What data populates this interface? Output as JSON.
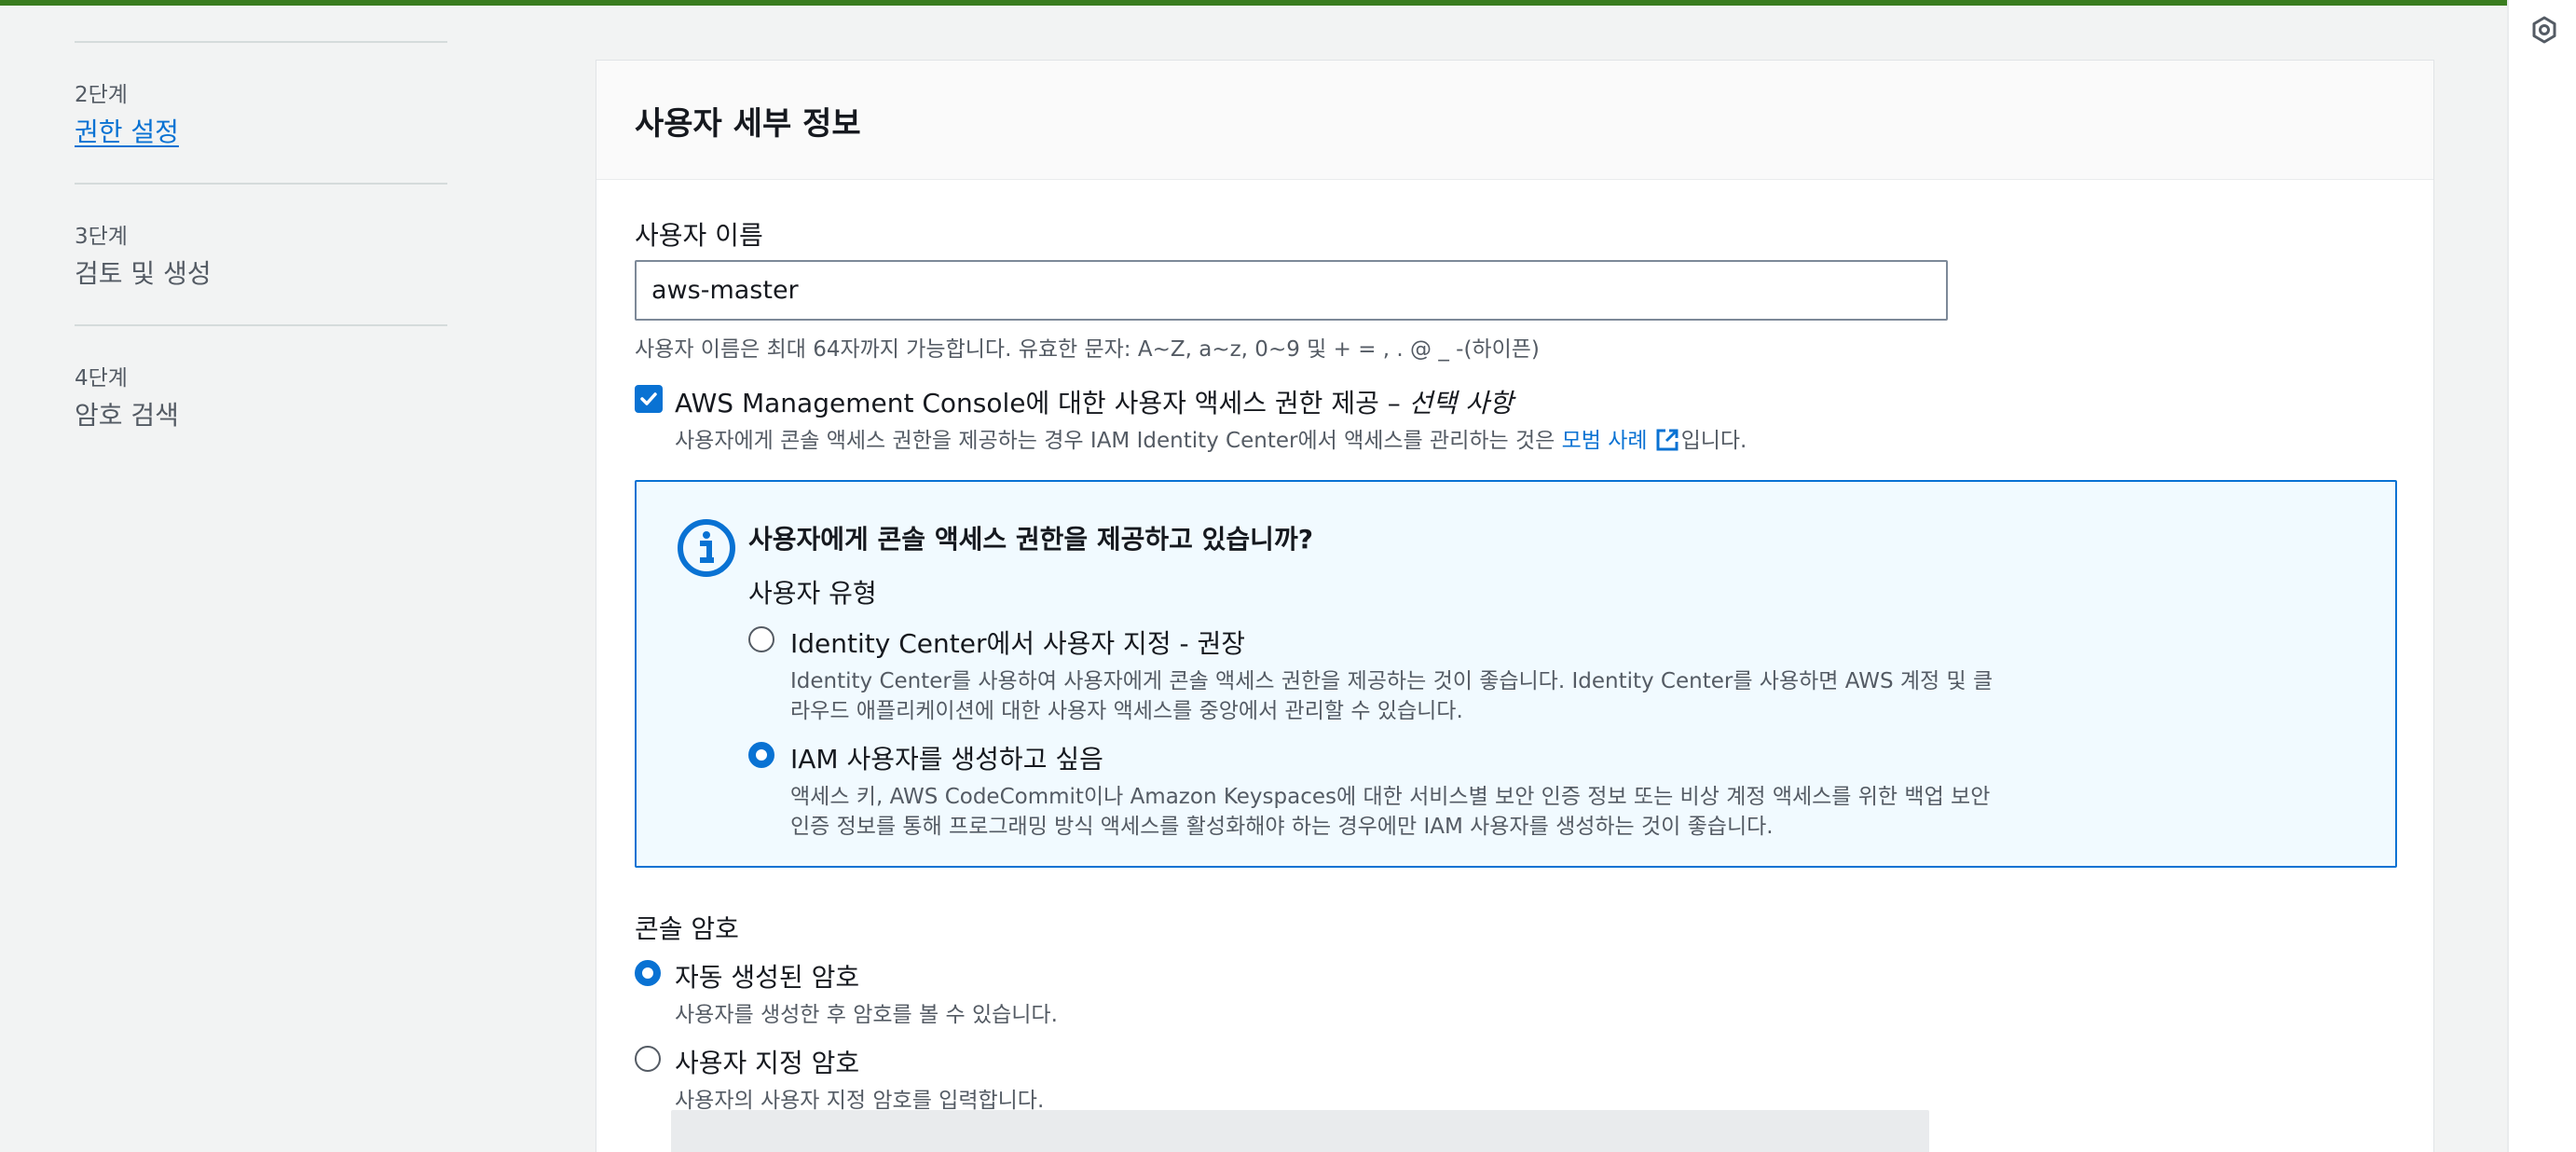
{
  "steps": [
    {
      "num": "2단계",
      "name": "권한 설정",
      "link": true
    },
    {
      "num": "3단계",
      "name": "검토 및 생성",
      "link": false
    },
    {
      "num": "4단계",
      "name": "암호 검색",
      "link": false
    }
  ],
  "panel": {
    "title": "사용자 세부 정보",
    "username_label": "사용자 이름",
    "username_value": "aws-master",
    "username_hint": "사용자 이름은 최대 64자까지 가능합니다. 유효한 문자: A~Z, a~z, 0~9 및 + = , . @ _ -(하이픈)",
    "console_access": {
      "checked": true,
      "label": "AWS Management Console에 대한 사용자 액세스 권한 제공 – ",
      "label_optional": "선택 사항",
      "desc_before": "사용자에게 콘솔 액세스 권한을 제공하는 경우 IAM Identity Center에서 액세스를 관리하는 것은 ",
      "desc_link": "모범 사례",
      "desc_after": "입니다."
    },
    "info": {
      "title": "사용자에게 콘솔 액세스 권한을 제공하고 있습니까?",
      "user_type_label": "사용자 유형",
      "options": [
        {
          "label": "Identity Center에서 사용자 지정 - 권장",
          "desc_line1": "Identity Center를 사용하여 사용자에게 콘솔 액세스 권한을 제공하는 것이 좋습니다. Identity Center를 사용하면 AWS 계정 및 클",
          "desc_line2": "라우드 애플리케이션에 대한 사용자 액세스를 중앙에서 관리할 수 있습니다.",
          "selected": false
        },
        {
          "label": "IAM 사용자를 생성하고 싶음",
          "desc_line1": "액세스 키, AWS CodeCommit이나 Amazon Keyspaces에 대한 서비스별 보안 인증 정보 또는 비상 계정 액세스를 위한 백업 보안",
          "desc_line2": "인증 정보를 통해 프로그래밍 방식 액세스를 활성화해야 하는 경우에만 IAM 사용자를 생성하는 것이 좋습니다.",
          "selected": true
        }
      ]
    },
    "console_password": {
      "label": "콘솔 암호",
      "options": [
        {
          "label": "자동 생성된 암호",
          "desc": "사용자를 생성한 후 암호를 볼 수 있습니다.",
          "selected": true
        },
        {
          "label": "사용자 지정 암호",
          "desc": "사용자의 사용자 지정 암호를 입력합니다.",
          "selected": false
        }
      ]
    }
  },
  "colors": {
    "accent": "#0972d3",
    "topbar": "#3a7d1f",
    "info_bg": "#f1faff"
  },
  "icons": [
    "info-circle-icon",
    "external-link-icon",
    "check-icon",
    "rail-settings-icon"
  ]
}
